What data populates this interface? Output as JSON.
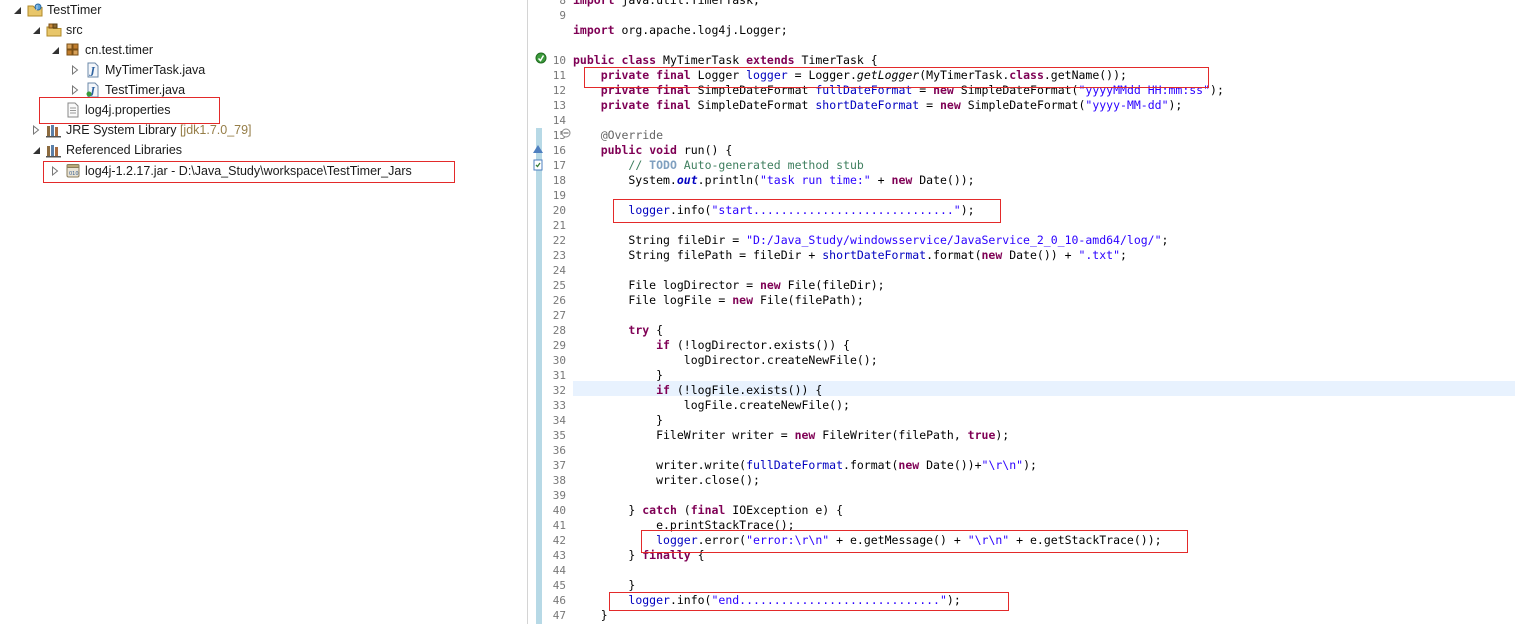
{
  "explorer": {
    "project": "TestTimer",
    "src": "src",
    "package": "cn.test.timer",
    "files": [
      "MyTimerTask.java",
      "TestTimer.java"
    ],
    "properties_file": "log4j.properties",
    "jre_label": "JRE System Library",
    "jre_hint": "[jdk1.7.0_79]",
    "ref_libs": "Referenced Libraries",
    "jar": "log4j-1.2.17.jar - D:\\Java_Study\\workspace\\TestTimer_Jars"
  },
  "editor": {
    "lines": [
      {
        "n": "8",
        "code": "import java.util.TimerTask;"
      },
      {
        "n": "9",
        "code": ""
      },
      {
        "n": "",
        "code": "import org.apache.log4j.Logger;"
      },
      {
        "n": "",
        "code": ""
      },
      {
        "n": "10",
        "code": "public class MyTimerTask extends TimerTask {"
      },
      {
        "n": "11",
        "code": "    private final Logger logger = Logger.getLogger(MyTimerTask.class.getName());"
      },
      {
        "n": "12",
        "code": "    private final SimpleDateFormat fullDateFormat = new SimpleDateFormat(\"yyyyMMdd HH:mm:ss\");"
      },
      {
        "n": "13",
        "code": "    private final SimpleDateFormat shortDateFormat = new SimpleDateFormat(\"yyyy-MM-dd\");"
      },
      {
        "n": "14",
        "code": ""
      },
      {
        "n": "15",
        "code": "    @Override"
      },
      {
        "n": "16",
        "code": "    public void run() {"
      },
      {
        "n": "17",
        "code": "        // TODO Auto-generated method stub"
      },
      {
        "n": "18",
        "code": "        System.out.println(\"task run time:\" + new Date());"
      },
      {
        "n": "19",
        "code": ""
      },
      {
        "n": "20",
        "code": "        logger.info(\"start.............................\");"
      },
      {
        "n": "21",
        "code": ""
      },
      {
        "n": "22",
        "code": "        String fileDir = \"D:/Java_Study/windowsservice/JavaService_2_0_10-amd64/log/\";"
      },
      {
        "n": "23",
        "code": "        String filePath = fileDir + shortDateFormat.format(new Date()) + \".txt\";"
      },
      {
        "n": "24",
        "code": ""
      },
      {
        "n": "25",
        "code": "        File logDirector = new File(fileDir);"
      },
      {
        "n": "26",
        "code": "        File logFile = new File(filePath);"
      },
      {
        "n": "27",
        "code": ""
      },
      {
        "n": "28",
        "code": "        try {"
      },
      {
        "n": "29",
        "code": "            if (!logDirector.exists()) {"
      },
      {
        "n": "30",
        "code": "                logDirector.createNewFile();"
      },
      {
        "n": "31",
        "code": "            }"
      },
      {
        "n": "32",
        "code": "            if (!logFile.exists()) {"
      },
      {
        "n": "33",
        "code": "                logFile.createNewFile();"
      },
      {
        "n": "34",
        "code": "            }"
      },
      {
        "n": "35",
        "code": "            FileWriter writer = new FileWriter(filePath, true);"
      },
      {
        "n": "36",
        "code": ""
      },
      {
        "n": "37",
        "code": "            writer.write(fullDateFormat.format(new Date())+\"\\r\\n\");"
      },
      {
        "n": "38",
        "code": "            writer.close();"
      },
      {
        "n": "39",
        "code": ""
      },
      {
        "n": "40",
        "code": "        } catch (final IOException e) {"
      },
      {
        "n": "41",
        "code": "            e.printStackTrace();"
      },
      {
        "n": "42",
        "code": "            logger.error(\"error:\\r\\n\" + e.getMessage() + \"\\r\\n\" + e.getStackTrace());"
      },
      {
        "n": "43",
        "code": "        } finally {"
      },
      {
        "n": "44",
        "code": ""
      },
      {
        "n": "45",
        "code": "        }"
      },
      {
        "n": "46",
        "code": "        logger.info(\"end.............................\");"
      },
      {
        "n": "47",
        "code": "    }"
      }
    ]
  }
}
